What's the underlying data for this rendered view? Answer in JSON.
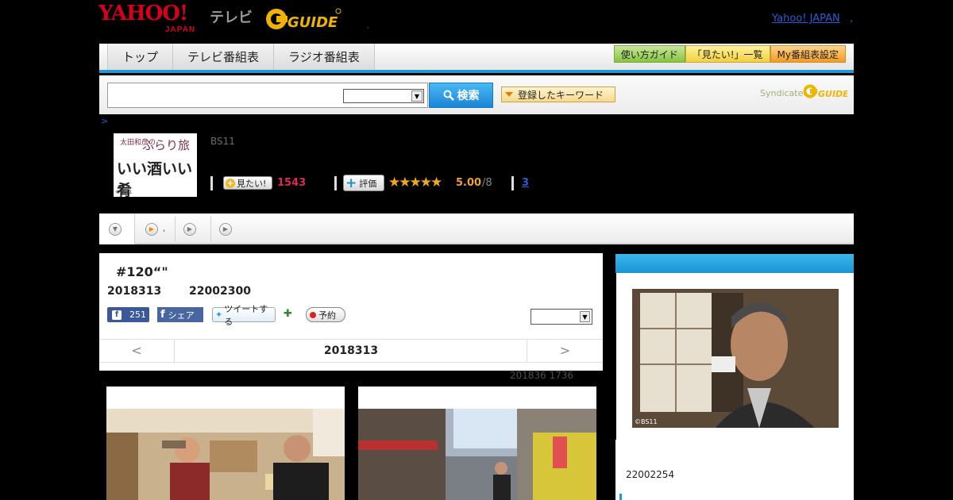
{
  "header": {
    "yahoo_logo": "YAHOO!",
    "yahoo_logo_sub": "JAPAN",
    "tv_label": "テレビ",
    "gguide_logo": "GUIDE",
    "yahoo_japan_link": "Yahoo! JAPAN",
    "link_sep": ",",
    "dot": ","
  },
  "nav": {
    "tabs": [
      {
        "label": "トップ"
      },
      {
        "label": "テレビ番組表"
      },
      {
        "label": "ラジオ番組表"
      }
    ],
    "buttons": [
      {
        "label": "使い方ガイド"
      },
      {
        "label": "「見たい!」一覧"
      },
      {
        "label": "My番組表設定"
      }
    ]
  },
  "search": {
    "input_value": "",
    "select_value": "",
    "button_label": "検索",
    "keyword_button_label": "登録したキーワード",
    "syndicated_label": "Syndicated",
    "syndicated_logo": "GUIDE"
  },
  "breadcrumb": ">",
  "program": {
    "thumb_line1": "太田和彦の",
    "thumb_line2": "ふらり旅",
    "thumb_line3": "いい酒いい肴",
    "thumb_credit": "©BS11",
    "channel": "BS11",
    "mitai_label": "見たい!",
    "mitai_count": "1543",
    "hyoka_label": "評価",
    "stars": "★★★★★",
    "score": "5.00",
    "score_total": "/8",
    "review_link": "3"
  },
  "tabstrip": {
    "items": [
      {
        "label": ""
      },
      {
        "label": ","
      },
      {
        "label": ""
      },
      {
        "label": ""
      }
    ]
  },
  "episode": {
    "title": "#120“\"",
    "date": "2018313",
    "time": "22002300",
    "fb_count": "251",
    "fb_share_label": "シェア",
    "tweet_label": "ツイートする",
    "reserve_label": "予約",
    "select_value": "",
    "pager_prev": "<",
    "pager_current": "2018313",
    "pager_next": ">",
    "updated": "201836  1736"
  },
  "side": {
    "credit": "©BS11",
    "time": "22002254"
  },
  "colors": {
    "accent_blue": "#1e9bd7",
    "yahoo_red": "#d6001c",
    "mitai_pink": "#e1255b",
    "star_gold": "#f2a81b"
  }
}
